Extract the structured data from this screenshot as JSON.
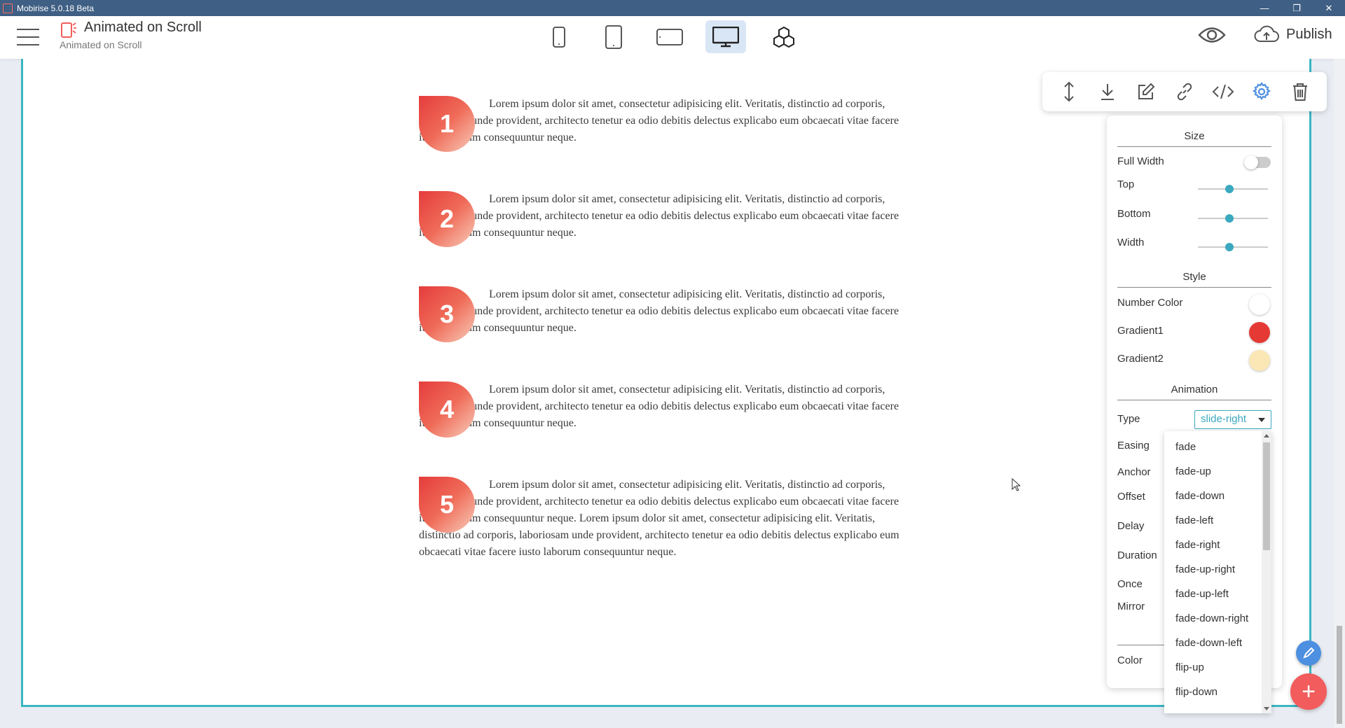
{
  "window": {
    "title": "Mobirise 5.0.18 Beta",
    "controls": [
      "minimize-icon",
      "restore-icon",
      "close-icon"
    ]
  },
  "header": {
    "page_title": "Animated on Scroll",
    "page_subtitle": "Animated on Scroll",
    "devices": [
      {
        "name": "mobile-portrait-icon",
        "active": false
      },
      {
        "name": "tablet-portrait-icon",
        "active": false
      },
      {
        "name": "tablet-landscape-icon",
        "active": false
      },
      {
        "name": "desktop-icon",
        "active": true
      },
      {
        "name": "extensions-cubes-icon",
        "active": false
      }
    ],
    "publish_label": "Publish"
  },
  "content": {
    "items": [
      {
        "number": "1",
        "text": "Lorem ipsum dolor sit amet, consectetur adipisicing elit. Veritatis, distinctio ad corporis, laboriosam unde provident, architecto tenetur ea odio debitis delectus explicabo eum obcaecati vitae facere iusto laborum consequuntur neque."
      },
      {
        "number": "2",
        "text": "Lorem ipsum dolor sit amet, consectetur adipisicing elit. Veritatis, distinctio ad corporis, laboriosam unde provident, architecto tenetur ea odio debitis delectus explicabo eum obcaecati vitae facere iusto laborum consequuntur neque."
      },
      {
        "number": "3",
        "text": "Lorem ipsum dolor sit amet, consectetur adipisicing elit. Veritatis, distinctio ad corporis, laboriosam unde provident, architecto tenetur ea odio debitis delectus explicabo eum obcaecati vitae facere iusto laborum consequuntur neque."
      },
      {
        "number": "4",
        "text": "Lorem ipsum dolor sit amet, consectetur adipisicing elit. Veritatis, distinctio ad corporis, laboriosam unde provident, architecto tenetur ea odio debitis delectus explicabo eum obcaecati vitae facere iusto laborum consequuntur neque."
      },
      {
        "number": "5",
        "text": "Lorem ipsum dolor sit amet, consectetur adipisicing elit. Veritatis, distinctio ad corporis, laboriosam unde provident, architecto tenetur ea odio debitis delectus explicabo eum obcaecati vitae facere iusto laborum consequuntur neque. Lorem ipsum dolor sit amet, consectetur adipisicing elit. Veritatis, distinctio ad corporis, laboriosam unde provident, architecto tenetur ea odio debitis delectus explicabo eum obcaecati vitae facere iusto laborum consequuntur neque."
      }
    ]
  },
  "block_toolbar": [
    "move-icon",
    "download-icon",
    "edit-icon",
    "link-icon",
    "code-icon",
    "gear-icon",
    "trash-icon"
  ],
  "settings": {
    "size_heading": "Size",
    "full_width_label": "Full Width",
    "full_width_on": false,
    "top_label": "Top",
    "top_value": 0.45,
    "bottom_label": "Bottom",
    "bottom_value": 0.45,
    "width_label": "Width",
    "width_value": 0.45,
    "style_heading": "Style",
    "number_color_label": "Number Color",
    "number_color": "#ffffff",
    "gradient1_label": "Gradient1",
    "gradient1": "#e53935",
    "gradient2_label": "Gradient2",
    "gradient2": "#fbe7b5",
    "animation_heading": "Animation",
    "type_label": "Type",
    "type_value": "slide-right",
    "easing_label": "Easing",
    "anchor_label": "Anchor",
    "offset_label": "Offset",
    "delay_label": "Delay",
    "duration_label": "Duration",
    "once_label": "Once",
    "mirror_label": "Mirror",
    "color_label": "Color"
  },
  "dropdown_options": [
    "fade",
    "fade-up",
    "fade-down",
    "fade-left",
    "fade-right",
    "fade-up-right",
    "fade-up-left",
    "fade-down-right",
    "fade-down-left",
    "flip-up",
    "flip-down"
  ],
  "colors": {
    "accent": "#3ab6c2",
    "fab_add": "#f25c5c",
    "fab_edit": "#4d8fe0",
    "titlebar": "#3f5f84"
  }
}
